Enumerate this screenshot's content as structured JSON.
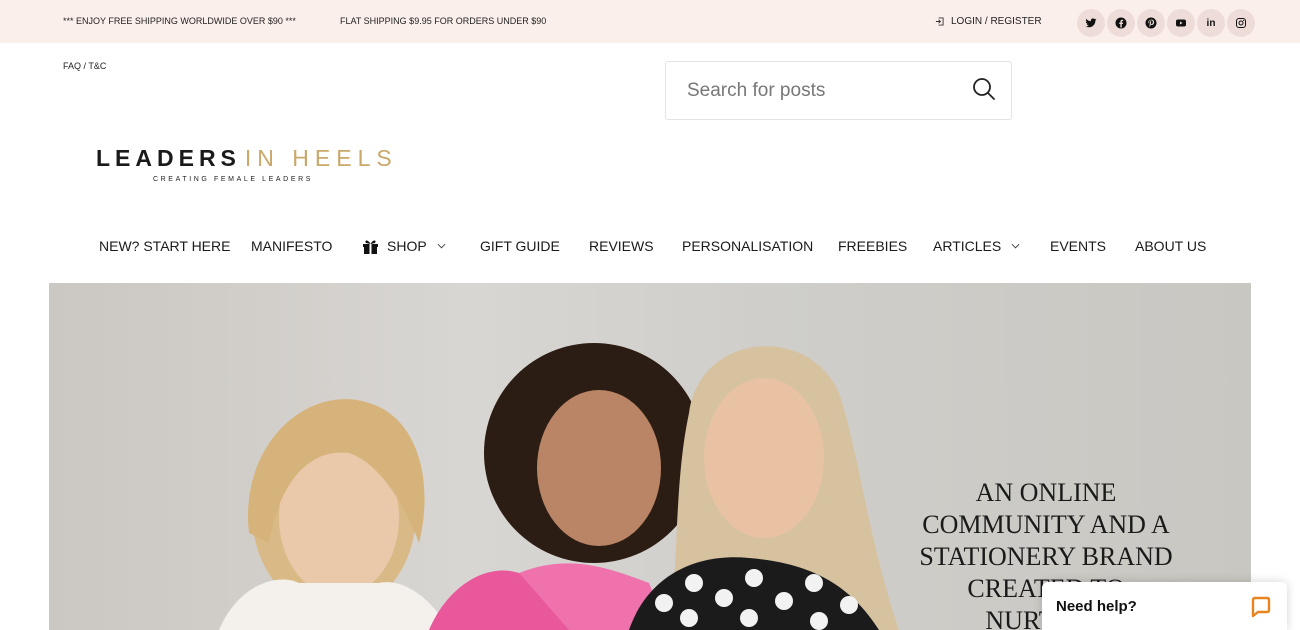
{
  "topbar": {
    "promo_free": "*** ENJOY FREE SHIPPING WORLDWIDE OVER $90 ***",
    "promo_flat": "FLAT SHIPPING $9.95 FOR ORDERS UNDER $90",
    "login_label": "LOGIN / REGISTER",
    "socials": [
      {
        "icon": "twitter-icon",
        "glyph": ""
      },
      {
        "icon": "facebook-icon",
        "glyph": ""
      },
      {
        "icon": "pinterest-icon",
        "glyph": ""
      },
      {
        "icon": "youtube-icon",
        "glyph": ""
      },
      {
        "icon": "linkedin-icon",
        "glyph": "in"
      },
      {
        "icon": "instagram-icon",
        "glyph": ""
      }
    ]
  },
  "header": {
    "faq_link": "FAQ / T&C",
    "search_placeholder": "Search for posts",
    "logo_word1": "LEADERS",
    "logo_word2": "IN HEELS",
    "logo_tagline": "CREATING FEMALE LEADERS"
  },
  "nav": {
    "items": [
      {
        "label": "NEW? START HERE"
      },
      {
        "label": "MANIFESTO"
      },
      {
        "label": "SHOP",
        "icon": "gift-icon",
        "dropdown": true
      },
      {
        "label": "GIFT GUIDE"
      },
      {
        "label": "REVIEWS"
      },
      {
        "label": "PERSONALISATION"
      },
      {
        "label": "FREEBIES"
      },
      {
        "label": "ARTICLES",
        "dropdown": true
      },
      {
        "label": "EVENTS"
      },
      {
        "label": "ABOUT US"
      }
    ]
  },
  "hero": {
    "headline": "AN ONLINE\nCOMMUNITY AND A\nSTATIONERY BRAND\nCREATED TO\nNURTURE"
  },
  "chat": {
    "label": "Need help?"
  },
  "colors": {
    "topbar_bg": "#fbefec",
    "logo_gold": "#c9a86a",
    "social_bg": "#eddcd8",
    "chat_accent": "#e8841c"
  }
}
